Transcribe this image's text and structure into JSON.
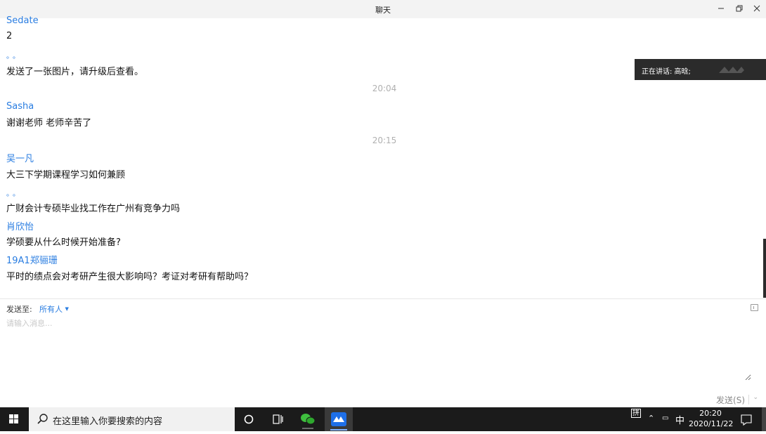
{
  "window": {
    "title": "聊天"
  },
  "messages": [
    {
      "name": "Sedate",
      "text": "2"
    },
    {
      "name": "。。",
      "text": "发送了一张图片，请升级后查看。"
    },
    {
      "time": "20:04"
    },
    {
      "name": "Sasha",
      "text": "谢谢老师 老师辛苦了"
    },
    {
      "time": "20:15"
    },
    {
      "name": "吴一凡",
      "text": "大三下学期课程学习如何兼顾"
    },
    {
      "name": "。。",
      "text": "广财会计专硕毕业找工作在广州有竞争力吗"
    },
    {
      "name": "肖欣怡",
      "text": "学硕要从什么时候开始准备?"
    },
    {
      "name": "19A1郑骊珊",
      "text": "平时的绩点会对考研产生很大影响吗？考证对考研有帮助吗？"
    }
  ],
  "speaking": {
    "text": "正在讲话: 高晗;"
  },
  "compose": {
    "sendto_label": "发送至:",
    "sendto_target": "所有人",
    "placeholder": "请输入消息...",
    "send_label": "发送(S)"
  },
  "taskbar": {
    "search_placeholder": "在这里输入你要搜索的内容",
    "ime_label": "拼",
    "lang": "中",
    "time": "20:20",
    "date": "2020/11/22"
  },
  "colors": {
    "accent": "#2a7de1",
    "taskbar": "#1b1b1b",
    "speaking_bg": "#2b2b2b"
  }
}
